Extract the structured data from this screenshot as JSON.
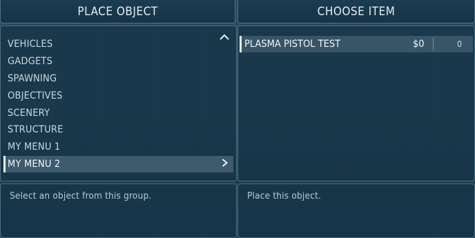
{
  "left_panel": {
    "header": "PLACE OBJECT",
    "items": [
      {
        "label": "VEHICLES"
      },
      {
        "label": "GADGETS"
      },
      {
        "label": "SPAWNING"
      },
      {
        "label": "OBJECTIVES"
      },
      {
        "label": "SCENERY"
      },
      {
        "label": "STRUCTURE"
      },
      {
        "label": "MY MENU 1"
      },
      {
        "label": "MY MENU 2"
      }
    ],
    "description": "Select an object from this group."
  },
  "right_panel": {
    "header": "CHOOSE ITEM",
    "items": [
      {
        "label": "PLASMA PISTOL TEST",
        "price": "$0",
        "quantity": "0"
      }
    ],
    "description": "Place this object."
  },
  "colors": {
    "panel_bg": "#163448",
    "border": "#7aa0b9",
    "highlight": "#e8f0f5"
  }
}
